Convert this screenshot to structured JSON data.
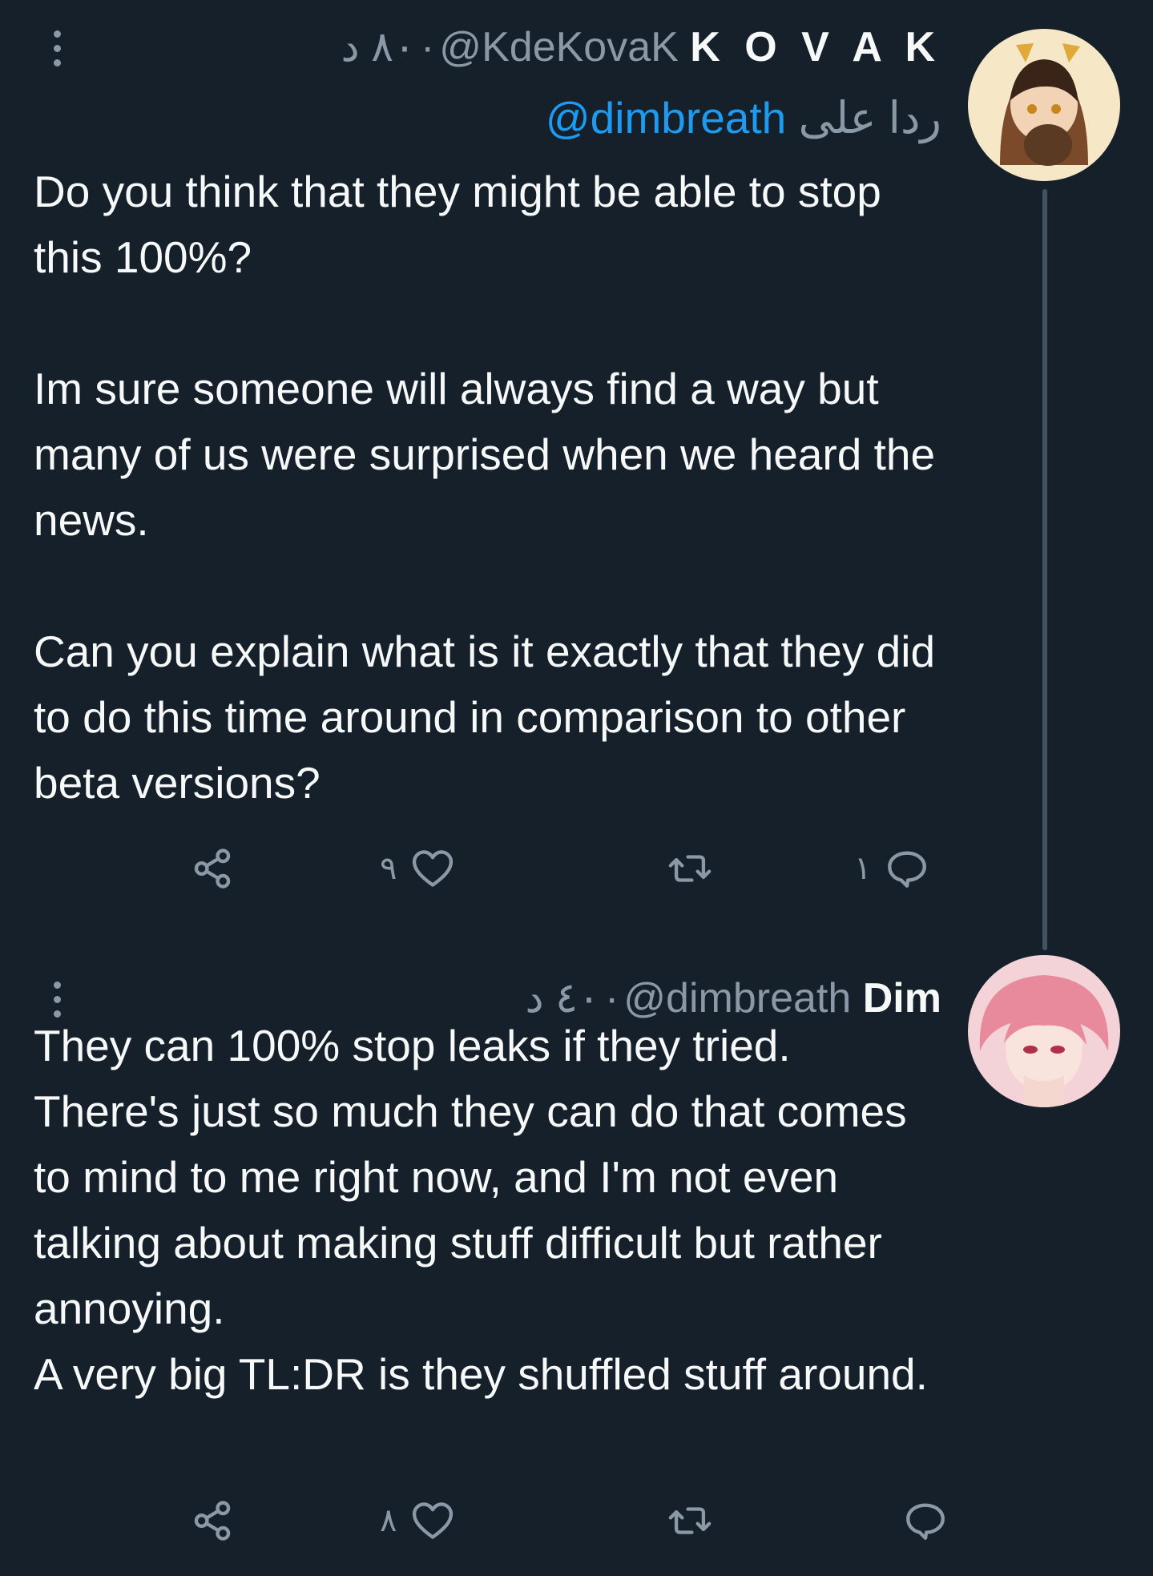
{
  "tweets": [
    {
      "name": "K O V A K",
      "handle": "@KdeKovaK",
      "separator": "·",
      "time": "٨٠ د",
      "reply_prefix": "ردا على",
      "reply_mention": "@dimbreath",
      "paragraphs": [
        "Do you think that they might be able to stop this 100%?",
        "Im sure someone will always find a way but many of us were surprised when we heard the news.",
        "Can you explain what is it exactly that they did to do this time around in comparison to other beta versions?"
      ],
      "actions": {
        "reply_count": "١",
        "retweet_count": "",
        "like_count": "٩"
      }
    },
    {
      "name": "Dim",
      "handle": "@dimbreath",
      "separator": "·",
      "time": "٤٠ د",
      "paragraphs": [
        "They can 100% stop leaks if they tried. There's just so much they can do that comes to mind to me right now, and I'm not even talking about making stuff difficult but rather annoying.",
        "A very big TL:DR is they shuffled stuff around."
      ],
      "actions": {
        "reply_count": "",
        "retweet_count": "",
        "like_count": "٨"
      }
    }
  ],
  "icons": {
    "more": "more-vertical-icon",
    "reply": "reply-bubble-icon",
    "retweet": "retweet-icon",
    "like": "heart-icon",
    "share": "share-icon"
  },
  "colors": {
    "background": "#15202b",
    "text": "#f7f9f9",
    "secondary": "#8b98a5",
    "accent": "#1d9bf0"
  }
}
